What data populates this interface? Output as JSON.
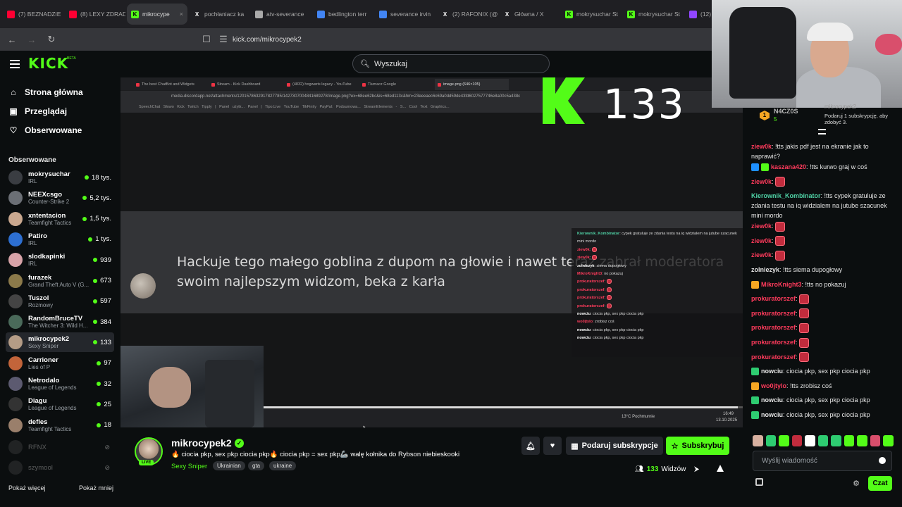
{
  "browser": {
    "tabs": [
      {
        "label": "(7) BEZNADZIE",
        "fav": "youtube",
        "color": "#ff0033",
        "active": false
      },
      {
        "label": "(8) LEXY ZDRAD",
        "fav": "youtube",
        "color": "#ff0033",
        "active": false
      },
      {
        "label": "mikrocype",
        "fav": "kick",
        "color": "#53fc18",
        "active": true
      },
      {
        "label": "pochłaniacz ka",
        "fav": "x",
        "color": "#ffffff",
        "active": false
      },
      {
        "label": "atv-severance",
        "fav": "web",
        "color": "#aaaaaa",
        "active": false
      },
      {
        "label": "bedlington terr",
        "fav": "google",
        "color": "#4285f4",
        "active": false
      },
      {
        "label": "severance irvin",
        "fav": "google",
        "color": "#4285f4",
        "active": false
      },
      {
        "label": "(2) RAFONIX (@",
        "fav": "x",
        "color": "#ffffff",
        "active": false
      },
      {
        "label": "Główna / X",
        "fav": "x",
        "color": "#ffffff",
        "active": false
      },
      {
        "label": "mokrysuchar St",
        "fav": "kick",
        "color": "#53fc18",
        "active": false
      },
      {
        "label": "mokrysuchar St",
        "fav": "kick",
        "color": "#53fc18",
        "active": false
      },
      {
        "label": "(12) p",
        "fav": "twitch",
        "color": "#9146ff",
        "active": false
      }
    ],
    "url": "kick.com/mikrocypek2"
  },
  "header": {
    "logo": "KICK",
    "beta": "BETA",
    "search_placeholder": "Wyszukaj"
  },
  "sidebar": {
    "nav": [
      {
        "label": "Strona główna",
        "icon": "home-icon"
      },
      {
        "label": "Przeglądaj",
        "icon": "browse-icon"
      },
      {
        "label": "Obserwowane",
        "icon": "heart-icon"
      }
    ],
    "followed_title": "Obserwowane",
    "followed": [
      {
        "name": "mokrysuchar",
        "category": "IRL",
        "viewers": "18 tys.",
        "avatar": "#3a3d42"
      },
      {
        "name": "NEEXcsgo",
        "category": "Counter-Strike 2",
        "viewers": "5,2 tys.",
        "avatar": "#6b6f75"
      },
      {
        "name": "xntentacion",
        "category": "Teamfight Tactics",
        "viewers": "1,5 tys.",
        "avatar": "#caa88f"
      },
      {
        "name": "Patiro",
        "category": "IRL",
        "viewers": "1 tys.",
        "avatar": "#2d6fd1"
      },
      {
        "name": "slodkapinki",
        "category": "IRL",
        "viewers": "939",
        "avatar": "#d8a3a8"
      },
      {
        "name": "furazek",
        "category": "Grand Theft Auto V (G...",
        "viewers": "673",
        "avatar": "#8c7a4a"
      },
      {
        "name": "Tuszol",
        "category": "Rozmowy",
        "viewers": "597",
        "avatar": "#444"
      },
      {
        "name": "RandomBruceTV",
        "category": "The Witcher 3: Wild H...",
        "viewers": "384",
        "avatar": "#4a6a5a"
      },
      {
        "name": "mikrocypek2",
        "category": "Sexy Sniper",
        "viewers": "133",
        "avatar": "#b49c86"
      },
      {
        "name": "Carrioner",
        "category": "Lies of P",
        "viewers": "97",
        "avatar": "#c2643a"
      },
      {
        "name": "Netrodalo",
        "category": "League of Legends",
        "viewers": "32",
        "avatar": "#5c5a70"
      },
      {
        "name": "Diagu",
        "category": "League of Legends",
        "viewers": "25",
        "avatar": "#333"
      },
      {
        "name": "defles",
        "category": "Teamfight Tactics",
        "viewers": "18",
        "avatar": "#9a7f6b"
      }
    ],
    "offline": [
      {
        "name": "RFNX"
      },
      {
        "name": "szymool"
      }
    ],
    "show_more": "Pokaż więcej",
    "show_less": "Pokaż mniej"
  },
  "video": {
    "inner_tabs": [
      "The best ChatBot and Widgets",
      "Stream - Kick Dashboard",
      "(4832) hogwarts legacy - YouTube",
      "Tłumacz Google",
      "image.png (646×105)"
    ],
    "inner_url": "media.discordapp.net/attachments/1201578632917827785/1427307004841689278/image.png?ex=68ee62bc&is=68ed113c&hm=23eeeaec6c69a0dd59de43fd6027577746e8a00c5a438c",
    "inner_bookmarks": "SpeechChat  Słowo  Kick  Twitch  Tipply | Panel użytk...  Panel | Tipo.Live  YouTube  TikFinity  PayPal: Podsumowa...  StreamElements - S...  Cool Text Graphics...",
    "overlay_count": "133",
    "message": "Hackuje tego małego goblina z dupom na głowie i nawet teraz zabrał moderatora swoim najlepszym widzom, beka z karła",
    "overlay_chat": [
      {
        "user": "Kierownik_Kombinator",
        "text": "cypek gratuluje ze zdania testu na iq widzialem na jutube szacunek mini mordo",
        "color": "#4fd1a5"
      },
      {
        "user": "ziew0k",
        "text": "",
        "color": "#ff3b5c"
      },
      {
        "user": "ziew0k",
        "text": "",
        "color": "#ff3b5c"
      },
      {
        "user": "zolniezyk",
        "text": "siema dupogłowy",
        "color": "#ffffff"
      },
      {
        "user": "MikroKnight3",
        "text": "no pokazuj",
        "color": "#ff3b5c"
      },
      {
        "user": "prokuratorszef",
        "text": "",
        "color": "#ff3b5c"
      },
      {
        "user": "prokuratorszef",
        "text": "",
        "color": "#ff3b5c"
      },
      {
        "user": "prokuratorszef",
        "text": "",
        "color": "#ff3b5c"
      },
      {
        "user": "prokuratorszef",
        "text": "",
        "color": "#ff3b5c"
      },
      {
        "user": "nowciu",
        "text": "ciocia pkp, sex pkp ciocia pkp",
        "color": "#ffffff"
      },
      {
        "user": "wo0jtylo",
        "text": "zrobisz coś",
        "color": "#ff3b5c"
      },
      {
        "user": "nowciu",
        "text": "ciocia pkp, sex pkp ciocia pkp",
        "color": "#ffffff"
      },
      {
        "user": "nowciu",
        "text": "ciocia pkp, sex pkp ciocia pkp",
        "color": "#ffffff"
      }
    ],
    "weather": "13°C Pochmurnie",
    "clock_time": "16:49",
    "clock_date": "13.10.2025",
    "progress": 0.99
  },
  "stream": {
    "channel": "mikrocypek2",
    "live": "LIVE",
    "title": "🔥 ciocia pkp, sex pkp ciocia pkp🔥 ciocia pkp = sex pkp🦾 walę kołnika do Rybson niebieskooki",
    "category": "Sexy Sniper",
    "tags": [
      "Ukrainian",
      "gta",
      "ukraine"
    ],
    "gift_label": "Podaruj subskrypcje",
    "subscribe_label": "Subskrybuj",
    "viewers": "133",
    "viewers_label": "Widzów"
  },
  "chat": {
    "pinned": {
      "rank": "1",
      "name": "N4CZ0S",
      "count": "5",
      "user": "mikrocypek2",
      "text": "Podaruj 1 subskrypcję, aby zdobyć 3."
    },
    "messages": [
      {
        "user": "ziew0k",
        "color": "#ff3b5c",
        "text": "!tts jakis pdf jest na ekranie jak to naprawić?",
        "emotes": 0
      },
      {
        "user": "kaszana420",
        "color": "#ff3b5c",
        "text": "!tts kurwo graj w coś",
        "emotes": 0,
        "badges": [
          "#1e90ff",
          "#53fc18"
        ]
      },
      {
        "user": "ziew0k",
        "color": "#ff3b5c",
        "text": "",
        "emotes": 1
      },
      {
        "user": "Kierownik_Kombinator",
        "color": "#4fd1a5",
        "text": "!tts cypek gratuluje ze zdania testu na iq widzialem na jutube szacunek mini mordo",
        "emotes": 0
      },
      {
        "user": "ziew0k",
        "color": "#ff3b5c",
        "text": "",
        "emotes": 1
      },
      {
        "user": "ziew0k",
        "color": "#ff3b5c",
        "text": "",
        "emotes": 1
      },
      {
        "user": "ziew0k",
        "color": "#ff3b5c",
        "text": "",
        "emotes": 1
      },
      {
        "user": "zolniezyk",
        "color": "#e6e6e6",
        "text": "!tts siema dupogłowy",
        "emotes": 0
      },
      {
        "user": "MikroKnight3",
        "color": "#ff3b5c",
        "text": "!tts no pokazuj",
        "emotes": 0,
        "badges": [
          "#f5a623"
        ]
      },
      {
        "user": "prokuratorszef",
        "color": "#ff3b5c",
        "text": "",
        "emotes": 1
      },
      {
        "user": "prokuratorszef",
        "color": "#ff3b5c",
        "text": "",
        "emotes": 1
      },
      {
        "user": "prokuratorszef",
        "color": "#ff3b5c",
        "text": "",
        "emotes": 1
      },
      {
        "user": "prokuratorszef",
        "color": "#ff3b5c",
        "text": "",
        "emotes": 1
      },
      {
        "user": "prokuratorszef",
        "color": "#ff3b5c",
        "text": "",
        "emotes": 1
      },
      {
        "user": "nowciu",
        "color": "#e6e6e6",
        "text": "ciocia pkp, sex pkp ciocia pkp",
        "emotes": 0,
        "badges": [
          "#2ecc71"
        ]
      },
      {
        "user": "wo0jtylo",
        "color": "#ff3b5c",
        "text": "!tts zrobisz coś",
        "emotes": 0,
        "badges": [
          "#f5a623"
        ]
      },
      {
        "user": "nowciu",
        "color": "#e6e6e6",
        "text": "ciocia pkp, sex pkp ciocia pkp",
        "emotes": 0,
        "badges": [
          "#2ecc71"
        ]
      },
      {
        "user": "nowciu",
        "color": "#e6e6e6",
        "text": "ciocia pkp, sex pkp ciocia pkp",
        "emotes": 0,
        "badges": [
          "#2ecc71"
        ]
      }
    ],
    "emote_colors": [
      "#d8b0a0",
      "#2ecc71",
      "#53fc18",
      "#c22c3d",
      "#ffffff",
      "#2ecc71",
      "#2ecc71",
      "#53fc18",
      "#53fc18",
      "#d94f6c",
      "#53fc18"
    ],
    "input_placeholder": "Wyślij wiadomość",
    "send_label": "Czat"
  },
  "colors": {
    "accent": "#53fc18",
    "bg": "#0b0e0f"
  }
}
